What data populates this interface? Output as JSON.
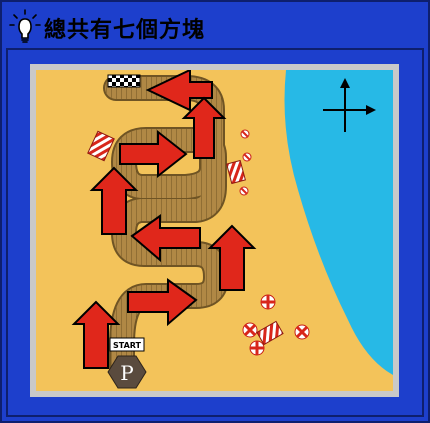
{
  "header": {
    "title": "總共有七個方塊",
    "icon": "lightbulb-icon"
  },
  "map": {
    "start_label": "START",
    "parking_label": "P",
    "arrows_count": 7,
    "colors": {
      "sand": "#f3c35a",
      "sea": "#27b9e6",
      "boardwalk": "#b08845",
      "arrow": "#e0271b",
      "frame": "#c9c9c9",
      "background": "#1d3fcc"
    },
    "icons": [
      "compass-cross-icon",
      "parking-sign-icon",
      "checkered-finish-flag",
      "beach-umbrella-icon",
      "beach-towel-icon"
    ]
  }
}
